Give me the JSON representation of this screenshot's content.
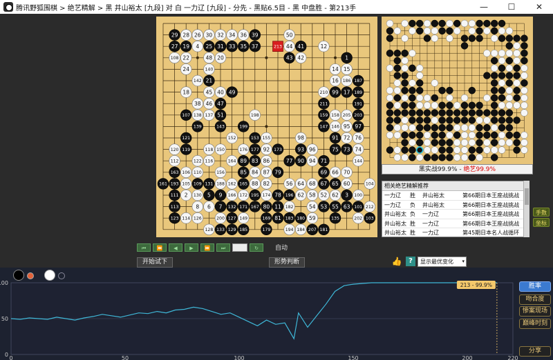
{
  "window": {
    "title": "腾讯野狐围棋 > 绝艺精解 > 黑 井山裕太 [九段] 对 白 一力辽 [九段] - 分先 - 黑贴6.5目 - 黑 中盘胜 - 第213手",
    "minimize": "—",
    "maximize": "☐",
    "close": "✕"
  },
  "board": {
    "size": 19,
    "last_move": "213",
    "stones": [
      [
        "29",
        "b",
        1,
        1
      ],
      [
        "28",
        "w",
        2,
        1
      ],
      [
        "26",
        "w",
        3,
        1
      ],
      [
        "30",
        "w",
        4,
        1
      ],
      [
        "32",
        "w",
        5,
        1
      ],
      [
        "34",
        "w",
        6,
        1
      ],
      [
        "36",
        "w",
        7,
        1
      ],
      [
        "39",
        "b",
        8,
        1
      ],
      [
        "50",
        "w",
        11,
        1
      ],
      [
        "27",
        "b",
        1,
        2
      ],
      [
        "19",
        "b",
        2,
        2
      ],
      [
        "4",
        "w",
        3,
        2
      ],
      [
        "25",
        "b",
        4,
        2
      ],
      [
        "31",
        "b",
        5,
        2
      ],
      [
        "33",
        "b",
        6,
        2
      ],
      [
        "35",
        "b",
        7,
        2
      ],
      [
        "37",
        "b",
        8,
        2
      ],
      [
        "213",
        "r",
        10,
        2
      ],
      [
        "44",
        "w",
        11,
        2
      ],
      [
        "41",
        "b",
        12,
        2
      ],
      [
        "12",
        "w",
        14,
        2
      ],
      [
        "108",
        "w",
        1,
        3
      ],
      [
        "22",
        "w",
        2,
        3
      ],
      [
        "48",
        "w",
        4,
        3
      ],
      [
        "20",
        "w",
        5,
        3
      ],
      [
        "43",
        "b",
        11,
        3
      ],
      [
        "42",
        "w",
        12,
        3
      ],
      [
        "1",
        "b",
        16,
        3
      ],
      [
        "24",
        "w",
        2,
        4
      ],
      [
        "140",
        "w",
        4,
        4
      ],
      [
        "14",
        "w",
        15,
        4
      ],
      [
        "15",
        "w",
        16,
        4
      ],
      [
        "142",
        "w",
        3,
        5
      ],
      [
        "21",
        "b",
        4,
        5
      ],
      [
        "16",
        "w",
        15,
        5
      ],
      [
        "186",
        "w",
        16,
        5
      ],
      [
        "187",
        "b",
        17,
        5
      ],
      [
        "18",
        "w",
        2,
        6
      ],
      [
        "45",
        "w",
        4,
        6
      ],
      [
        "40",
        "w",
        5,
        6
      ],
      [
        "49",
        "b",
        6,
        6
      ],
      [
        "210",
        "w",
        14,
        6
      ],
      [
        "99",
        "b",
        15,
        6
      ],
      [
        "17",
        "b",
        16,
        6
      ],
      [
        "189",
        "b",
        17,
        6
      ],
      [
        "38",
        "w",
        3,
        7
      ],
      [
        "46",
        "w",
        4,
        7
      ],
      [
        "47",
        "b",
        5,
        7
      ],
      [
        "211",
        "b",
        14,
        7
      ],
      [
        "191",
        "b",
        17,
        7
      ],
      [
        "107",
        "b",
        2,
        8
      ],
      [
        "138",
        "w",
        3,
        8
      ],
      [
        "137",
        "w",
        4,
        8
      ],
      [
        "51",
        "b",
        5,
        8
      ],
      [
        "198",
        "w",
        8,
        8
      ],
      [
        "159",
        "b",
        14,
        8
      ],
      [
        "158",
        "w",
        15,
        8
      ],
      [
        "205",
        "w",
        16,
        8
      ],
      [
        "203",
        "b",
        17,
        8
      ],
      [
        "139",
        "b",
        3,
        9
      ],
      [
        "143",
        "b",
        5,
        9
      ],
      [
        "199",
        "b",
        7,
        9
      ],
      [
        "147",
        "b",
        14,
        9
      ],
      [
        "146",
        "w",
        15,
        9
      ],
      [
        "95",
        "w",
        16,
        9
      ],
      [
        "97",
        "b",
        17,
        9
      ],
      [
        "121",
        "b",
        2,
        10
      ],
      [
        "152",
        "w",
        6,
        10
      ],
      [
        "153",
        "b",
        8,
        10
      ],
      [
        "155",
        "w",
        9,
        10
      ],
      [
        "98",
        "w",
        12,
        10
      ],
      [
        "91",
        "b",
        15,
        10
      ],
      [
        "72",
        "w",
        16,
        10
      ],
      [
        "76",
        "w",
        17,
        10
      ],
      [
        "120",
        "w",
        1,
        11
      ],
      [
        "119",
        "b",
        2,
        11
      ],
      [
        "118",
        "w",
        4,
        11
      ],
      [
        "150",
        "w",
        5,
        11
      ],
      [
        "176",
        "w",
        7,
        11
      ],
      [
        "177",
        "b",
        8,
        11
      ],
      [
        "92",
        "w",
        9,
        11
      ],
      [
        "173",
        "b",
        10,
        11
      ],
      [
        "93",
        "b",
        12,
        11
      ],
      [
        "96",
        "w",
        13,
        11
      ],
      [
        "75",
        "b",
        15,
        11
      ],
      [
        "73",
        "b",
        16,
        11
      ],
      [
        "74",
        "w",
        17,
        11
      ],
      [
        "112",
        "w",
        1,
        12
      ],
      [
        "122",
        "w",
        3,
        12
      ],
      [
        "116",
        "w",
        4,
        12
      ],
      [
        "164",
        "w",
        6,
        12
      ],
      [
        "89",
        "b",
        7,
        12
      ],
      [
        "83",
        "b",
        8,
        12
      ],
      [
        "86",
        "w",
        9,
        12
      ],
      [
        "77",
        "b",
        11,
        12
      ],
      [
        "90",
        "b",
        12,
        12
      ],
      [
        "94",
        "w",
        13,
        12
      ],
      [
        "71",
        "b",
        14,
        12
      ],
      [
        "144",
        "w",
        17,
        12
      ],
      [
        "163",
        "b",
        1,
        13
      ],
      [
        "106",
        "w",
        2,
        13
      ],
      [
        "110",
        "w",
        3,
        13
      ],
      [
        "156",
        "w",
        5,
        13
      ],
      [
        "85",
        "b",
        7,
        13
      ],
      [
        "84",
        "w",
        8,
        13
      ],
      [
        "87",
        "w",
        9,
        13
      ],
      [
        "79",
        "b",
        10,
        13
      ],
      [
        "69",
        "b",
        14,
        13
      ],
      [
        "66",
        "w",
        15,
        13
      ],
      [
        "70",
        "w",
        16,
        13
      ],
      [
        "161",
        "b",
        0,
        14
      ],
      [
        "193",
        "b",
        1,
        14
      ],
      [
        "105",
        "w",
        2,
        14
      ],
      [
        "109",
        "b",
        3,
        14
      ],
      [
        "131",
        "b",
        4,
        14
      ],
      [
        "188",
        "w",
        5,
        14
      ],
      [
        "162",
        "w",
        6,
        14
      ],
      [
        "165",
        "b",
        7,
        14
      ],
      [
        "88",
        "w",
        8,
        14
      ],
      [
        "82",
        "w",
        9,
        14
      ],
      [
        "56",
        "w",
        11,
        14
      ],
      [
        "64",
        "w",
        12,
        14
      ],
      [
        "68",
        "w",
        13,
        14
      ],
      [
        "67",
        "b",
        14,
        14
      ],
      [
        "65",
        "b",
        15,
        14
      ],
      [
        "60",
        "w",
        16,
        14
      ],
      [
        "104",
        "w",
        18,
        14
      ],
      [
        "111",
        "b",
        1,
        15
      ],
      [
        "2",
        "w",
        2,
        15
      ],
      [
        "130",
        "w",
        3,
        15
      ],
      [
        "5",
        "b",
        4,
        15
      ],
      [
        "9",
        "b",
        5,
        15
      ],
      [
        "166",
        "w",
        6,
        15
      ],
      [
        "172",
        "w",
        7,
        15
      ],
      [
        "195",
        "b",
        8,
        15
      ],
      [
        "174",
        "w",
        9,
        15
      ],
      [
        "78",
        "b",
        10,
        15
      ],
      [
        "196",
        "b",
        11,
        15
      ],
      [
        "62",
        "w",
        12,
        15
      ],
      [
        "58",
        "w",
        13,
        15
      ],
      [
        "52",
        "w",
        14,
        15
      ],
      [
        "62",
        "w",
        15,
        15
      ],
      [
        "3",
        "b",
        16,
        15
      ],
      [
        "100",
        "w",
        17,
        15
      ],
      [
        "113",
        "b",
        1,
        16
      ],
      [
        "8",
        "w",
        3,
        16
      ],
      [
        "6",
        "w",
        4,
        16
      ],
      [
        "7",
        "b",
        5,
        16
      ],
      [
        "132",
        "b",
        6,
        16
      ],
      [
        "171",
        "b",
        7,
        16
      ],
      [
        "167",
        "b",
        8,
        16
      ],
      [
        "80",
        "b",
        9,
        16
      ],
      [
        "11",
        "b",
        10,
        16
      ],
      [
        "182",
        "w",
        11,
        16
      ],
      [
        "54",
        "w",
        13,
        16
      ],
      [
        "53",
        "b",
        14,
        16
      ],
      [
        "55",
        "b",
        15,
        16
      ],
      [
        "63",
        "b",
        16,
        16
      ],
      [
        "101",
        "b",
        17,
        16
      ],
      [
        "212",
        "w",
        18,
        16
      ],
      [
        "123",
        "b",
        1,
        17
      ],
      [
        "114",
        "w",
        2,
        17
      ],
      [
        "126",
        "w",
        3,
        17
      ],
      [
        "200",
        "w",
        5,
        17
      ],
      [
        "127",
        "b",
        6,
        17
      ],
      [
        "149",
        "w",
        7,
        17
      ],
      [
        "169",
        "b",
        9,
        17
      ],
      [
        "81",
        "b",
        10,
        17
      ],
      [
        "183",
        "b",
        11,
        17
      ],
      [
        "180",
        "b",
        12,
        17
      ],
      [
        "59",
        "w",
        13,
        17
      ],
      [
        "135",
        "b",
        15,
        17
      ],
      [
        "202",
        "w",
        17,
        17
      ],
      [
        "103",
        "b",
        18,
        17
      ],
      [
        "128",
        "w",
        4,
        18
      ],
      [
        "133",
        "b",
        5,
        18
      ],
      [
        "129",
        "b",
        6,
        18
      ],
      [
        "185",
        "b",
        7,
        18
      ],
      [
        "179",
        "b",
        9,
        18
      ],
      [
        "194",
        "w",
        11,
        18
      ],
      [
        "184",
        "w",
        12,
        18
      ],
      [
        "207",
        "b",
        13,
        18
      ],
      [
        "181",
        "b",
        14,
        18
      ]
    ]
  },
  "mini": {
    "caption_black": "黑实战99.9%",
    "caption_sep": " - ",
    "caption_ai": "绝艺99.9%",
    "rows": [
      "o.oxxoxxoxooxxxx...",
      "xo.oxooxxo.oxoxoo..",
      "x.o..xo.o.xxx.oxxxx",
      "..........x.....xox",
      "xxxo.........ooooox",
      ".xo...........xoxox",
      "oxoxo.........oxoxo",
      ".xx.o........xxxxxo",
      ".oxox.o.......xoxox",
      "ooxxx..xx..x..xxoxo",
      "oxoxoox.o.o..oxxoxo",
      "xoxxoooxxoxxx.xoooo",
      "xxxxxxxxxxxxxxxxx.o",
      "xxoxxxoxxxxxooxxxx.",
      "xoooxxxxxoooxxoxx..",
      "ooxxxoxxoxooxxxoxxo",
      "..xoxoxxxoooxoxooxo",
      "xoxxoooxxooxxooo.xo",
      ".ooxoxxxxooxo.x...."
    ]
  },
  "games": {
    "header": "相关绝艺精解推荐",
    "rows": [
      {
        "p1": "一力辽",
        "res": "胜",
        "p2": "井山裕太",
        "name": "第66期日本王座战挑战"
      },
      {
        "p1": "一力辽",
        "res": "负",
        "p2": "井山裕太",
        "name": "第66期日本王座战挑战"
      },
      {
        "p1": "井山裕太",
        "res": "负",
        "p2": "一力辽",
        "name": "第66期日本王座战挑战"
      },
      {
        "p1": "井山裕太",
        "res": "胜",
        "p2": "一力辽",
        "name": "第66期日本王座战挑战"
      },
      {
        "p1": "井山裕太",
        "res": "胜",
        "p2": "一力辽",
        "name": "第45期日本名人战循环"
      }
    ]
  },
  "side": {
    "moves_btn": "手数",
    "coords_btn": "坐标"
  },
  "nav": {
    "first": "⏮",
    "prev5": "⏪",
    "prev": "◀",
    "next": "▶",
    "next5": "⏩",
    "last": "⏭",
    "loop": "↻",
    "auto": "自动"
  },
  "controls": {
    "try_btn": "开始试下",
    "judge_btn": "形势判断",
    "thumb": "👍",
    "help": "?",
    "select_value": "显示最优变化",
    "select_arrow": "▾"
  },
  "right_buttons": {
    "winrate": "胜率",
    "fit": "吻合度",
    "live": "惨案现场",
    "peak": "巅峰时刻",
    "share": "分享"
  },
  "chart_data": {
    "type": "line",
    "xlim": [
      0,
      220
    ],
    "ylim": [
      0,
      100
    ],
    "xticks": [
      "0",
      "50",
      "100",
      "150",
      "200",
      "220"
    ],
    "yticks": [
      "0",
      "50",
      "100"
    ],
    "marker_label": "213 - 99.9%",
    "marker_x": 213,
    "colors": {
      "line": "#3fb8d8",
      "marker": "#f5c96b"
    },
    "x": [
      0,
      4,
      8,
      12,
      16,
      20,
      24,
      28,
      32,
      36,
      40,
      44,
      48,
      52,
      56,
      60,
      64,
      68,
      72,
      76,
      80,
      84,
      88,
      92,
      96,
      100,
      104,
      108,
      112,
      116,
      120,
      124,
      126,
      130,
      134,
      138,
      142,
      146,
      150,
      154,
      158,
      162,
      166,
      170,
      174,
      178,
      182,
      186,
      190,
      194,
      198,
      202,
      206,
      210,
      213
    ],
    "values": [
      50,
      49,
      51,
      50,
      49,
      52,
      50,
      48,
      51,
      53,
      56,
      54,
      52,
      55,
      58,
      57,
      60,
      58,
      62,
      63,
      66,
      64,
      60,
      56,
      58,
      52,
      46,
      40,
      48,
      42,
      44,
      22,
      58,
      38,
      54,
      70,
      88,
      96,
      98,
      99,
      100,
      100,
      100,
      100,
      100,
      100,
      100,
      100,
      100,
      100,
      100,
      100,
      100,
      100,
      100
    ]
  }
}
